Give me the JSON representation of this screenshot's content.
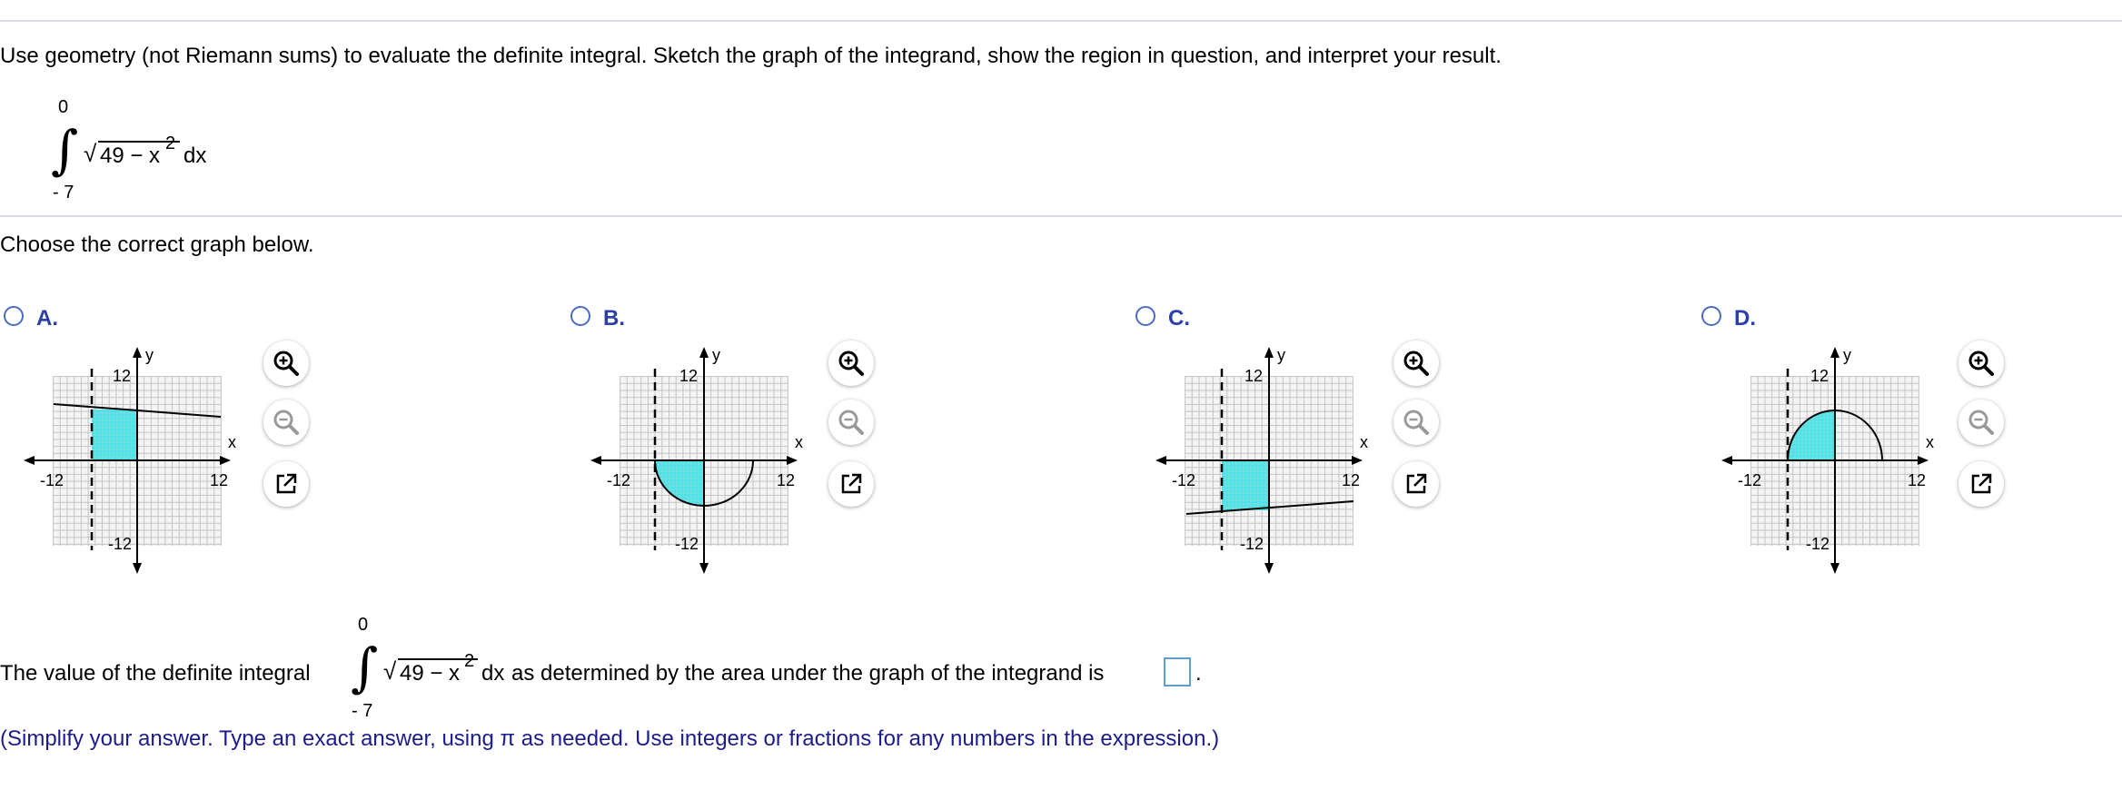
{
  "question": {
    "prompt": "Use geometry (not Riemann sums) to evaluate the definite integral. Sketch the graph of the integrand, show the region in question, and interpret your result.",
    "integral": {
      "upper": "0",
      "lower": "- 7",
      "integrand": "49 − x",
      "exponent": "2",
      "differential": "dx"
    }
  },
  "choose_text": "Choose the correct graph below.",
  "options": [
    {
      "letter": "A.",
      "ymax_label": "12",
      "ymin_label": "-12",
      "xmin_label": "-12",
      "xmax_label": "12",
      "x_axis": "x",
      "y_axis": "y"
    },
    {
      "letter": "B.",
      "ymax_label": "12",
      "ymin_label": "-12",
      "xmin_label": "-12",
      "xmax_label": "12",
      "x_axis": "x",
      "y_axis": "y"
    },
    {
      "letter": "C.",
      "ymax_label": "12",
      "ymin_label": "-12",
      "xmin_label": "-12",
      "xmax_label": "12",
      "x_axis": "x",
      "y_axis": "y"
    },
    {
      "letter": "D.",
      "ymax_label": "12",
      "ymin_label": "-12",
      "xmin_label": "-12",
      "xmax_label": "12",
      "x_axis": "x",
      "y_axis": "y"
    }
  ],
  "answer": {
    "prefix": "The value of the definite integral",
    "suffix": "as determined by the area under the graph of the integrand is",
    "period": ".",
    "hint": "(Simplify your answer. Type an exact answer, using π as needed. Use integers or fractions for any numbers in the expression.)",
    "value": ""
  },
  "icons": [
    "zoom-in-icon",
    "zoom-out-icon",
    "popout-icon",
    "radio-icon"
  ],
  "colors": {
    "region": "#40e6ec",
    "radio": "#4a6cc4",
    "label": "#2a3fa8",
    "hint": "#1c1c8c"
  }
}
